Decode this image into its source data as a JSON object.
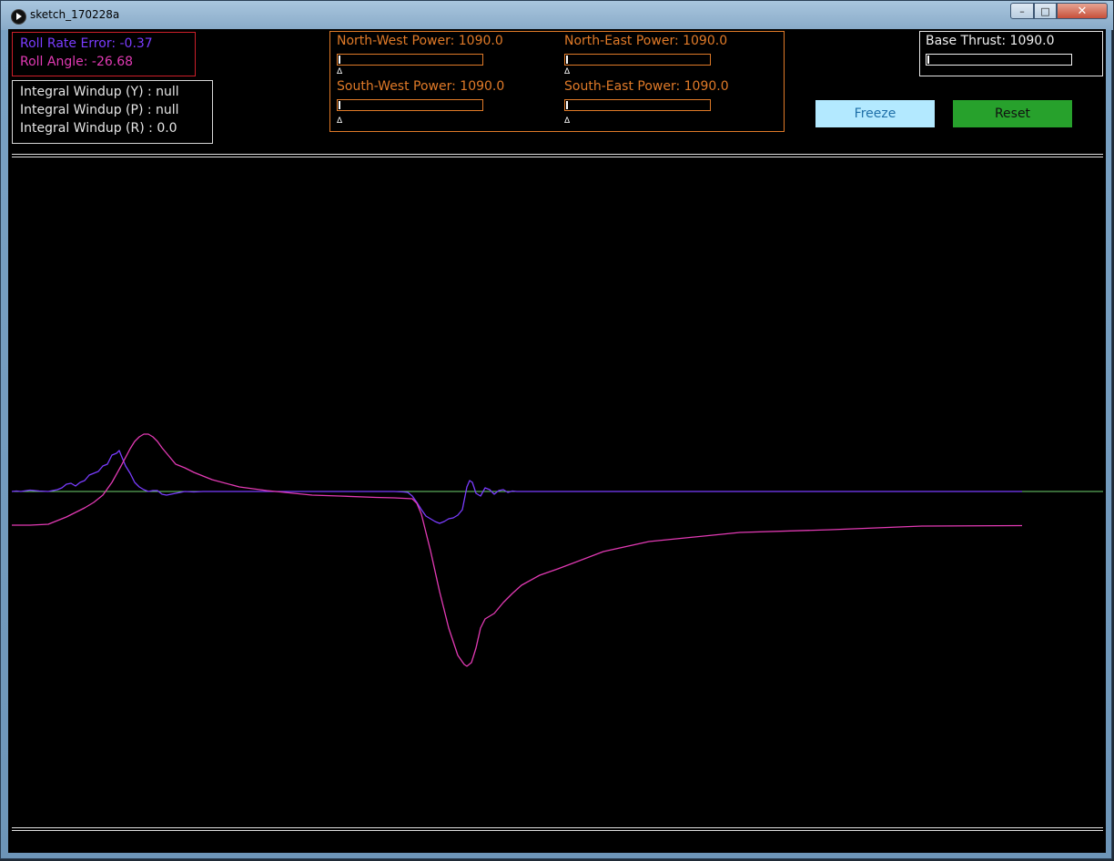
{
  "window": {
    "title": "sketch_170228a",
    "app_icon": "play-icon",
    "controls": {
      "minimize": "–",
      "maximize": "□",
      "close": "✕"
    }
  },
  "telemetry": {
    "roll_rate_error_label": "Roll Rate Error: -0.37",
    "roll_angle_label": "Roll Angle: -26.68",
    "roll_rate_error": -0.37,
    "roll_angle": -26.68,
    "roll_rate_color": "#7a3cff",
    "roll_angle_color": "#e23ab4"
  },
  "windup": {
    "y_label": "Integral Windup (Y) : null",
    "p_label": "Integral Windup (P) : null",
    "r_label": "Integral Windup (R) : 0.0"
  },
  "motors": {
    "color": "#e07a28",
    "north_west": {
      "label": "North-West Power: 1090.0",
      "level": 0.0
    },
    "north_east": {
      "label": "North-East Power: 1090.0",
      "level": 0.0
    },
    "south_west": {
      "label": "South-West Power: 1090.0",
      "level": 0.0
    },
    "south_east": {
      "label": "South-East Power: 1090.0",
      "level": 0.0
    },
    "marker": "Δ"
  },
  "thrust": {
    "label": "Base Thrust: 1090.0",
    "level": 0.0
  },
  "buttons": {
    "freeze": "Freeze",
    "reset": "Reset",
    "freeze_color": "#b3e9ff",
    "reset_color": "#27a12c"
  },
  "chart_data": {
    "type": "line",
    "grid": false,
    "baseline_color": "#6fd36f",
    "series": [
      {
        "key": "roll_rate_error",
        "color": "#7a3cff",
        "x": [
          0,
          5,
          10,
          20,
          25,
          30,
          40,
          50,
          55,
          60,
          65,
          70,
          75,
          80,
          85,
          90,
          95,
          100,
          105,
          110,
          115,
          118,
          120,
          125,
          130,
          135,
          140,
          145,
          150,
          155,
          160,
          165,
          170,
          180,
          190,
          200,
          210,
          220,
          260,
          300,
          350,
          400,
          420,
          430,
          435,
          440,
          445,
          450,
          455,
          460,
          465,
          470,
          475,
          480,
          485,
          490,
          495,
          500,
          503,
          506,
          510,
          515,
          520,
          525,
          530,
          535,
          540,
          545,
          550,
          555,
          560,
          565,
          570,
          580,
          590,
          600,
          700,
          800,
          900,
          1000,
          1110
        ],
        "y": [
          0,
          0.5,
          0,
          1.5,
          1,
          0.5,
          0,
          2,
          4,
          8,
          9,
          6,
          10,
          12,
          18,
          20,
          22,
          28,
          30,
          40,
          42,
          45,
          40,
          28,
          20,
          10,
          5,
          2,
          0,
          1,
          1,
          -3,
          -4,
          -2,
          0,
          -0.5,
          0,
          0,
          0,
          0,
          0,
          0,
          0,
          -0.5,
          -1,
          -5,
          -12,
          -20,
          -27,
          -30,
          -33,
          -35,
          -33,
          -30,
          -29,
          -26,
          -20,
          5,
          12,
          10,
          -2,
          -5,
          4,
          2,
          -3,
          1,
          2,
          -1,
          0.5,
          0,
          0,
          0,
          0,
          0,
          0,
          0,
          0,
          0,
          0,
          0,
          0
        ]
      },
      {
        "key": "roll_angle",
        "color": "#e23ab4",
        "x": [
          0,
          20,
          40,
          60,
          80,
          90,
          100,
          110,
          120,
          130,
          135,
          140,
          145,
          150,
          155,
          160,
          165,
          170,
          175,
          180,
          190,
          200,
          220,
          250,
          280,
          300,
          330,
          360,
          400,
          420,
          430,
          440,
          445,
          450,
          460,
          470,
          480,
          490,
          497,
          500,
          505,
          510,
          515,
          520,
          530,
          540,
          550,
          560,
          580,
          600,
          650,
          700,
          800,
          900,
          1000,
          1110
        ],
        "y": [
          -37,
          -37,
          -36,
          -28,
          -18,
          -12,
          -4,
          10,
          28,
          47,
          55,
          60,
          63,
          63,
          60,
          55,
          48,
          42,
          36,
          30,
          26,
          21,
          13,
          5,
          1,
          -1,
          -4,
          -5,
          -6.5,
          -7,
          -7.5,
          -8,
          -13,
          -25,
          -65,
          -110,
          -150,
          -180,
          -190,
          -192,
          -188,
          -172,
          -150,
          -140,
          -134,
          -122,
          -112,
          -103,
          -92,
          -85,
          -66,
          -55,
          -45,
          -42,
          -38,
          -37.5
        ]
      }
    ]
  }
}
